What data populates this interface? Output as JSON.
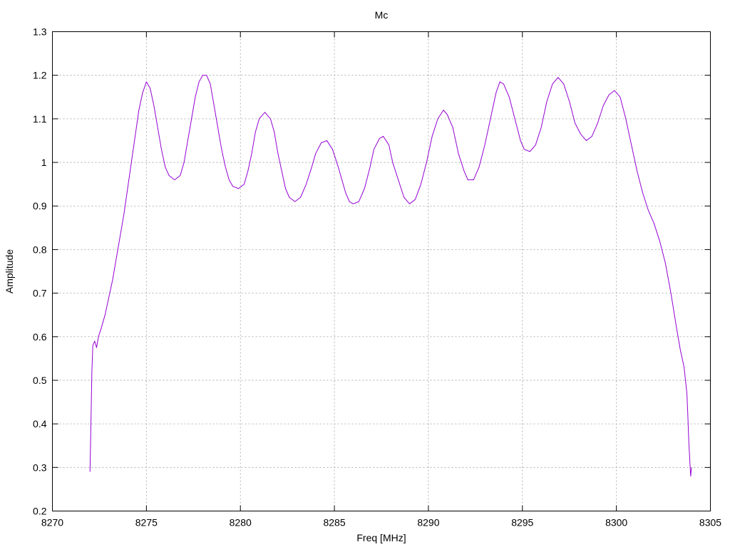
{
  "chart_data": {
    "type": "line",
    "title": "Mc",
    "xlabel": "Freq [MHz]",
    "ylabel": "Amplitude",
    "xlim": [
      8270,
      8305
    ],
    "ylim": [
      0.2,
      1.3
    ],
    "x_ticks": [
      8270,
      8275,
      8280,
      8285,
      8290,
      8295,
      8300,
      8305
    ],
    "y_ticks": [
      0.2,
      0.3,
      0.4,
      0.5,
      0.6,
      0.7,
      0.8,
      0.9,
      1,
      1.1,
      1.2,
      1.3
    ],
    "y_tick_labels": [
      "0.2",
      "0.3",
      "0.4",
      "0.5",
      "0.6",
      "0.7",
      "0.8",
      "0.9",
      "1",
      "1.1",
      "1.2",
      "1.3"
    ],
    "grid": true,
    "legend": "none",
    "series": [
      {
        "color": "#9400d3",
        "points": [
          [
            8272.0,
            0.29
          ],
          [
            8272.05,
            0.4
          ],
          [
            8272.1,
            0.52
          ],
          [
            8272.15,
            0.58
          ],
          [
            8272.25,
            0.59
          ],
          [
            8272.35,
            0.575
          ],
          [
            8272.45,
            0.6
          ],
          [
            8272.6,
            0.62
          ],
          [
            8272.8,
            0.65
          ],
          [
            8273.0,
            0.69
          ],
          [
            8273.2,
            0.73
          ],
          [
            8273.4,
            0.78
          ],
          [
            8273.6,
            0.83
          ],
          [
            8273.8,
            0.88
          ],
          [
            8274.0,
            0.94
          ],
          [
            8274.2,
            1.0
          ],
          [
            8274.4,
            1.06
          ],
          [
            8274.6,
            1.12
          ],
          [
            8274.8,
            1.16
          ],
          [
            8275.0,
            1.185
          ],
          [
            8275.2,
            1.17
          ],
          [
            8275.4,
            1.13
          ],
          [
            8275.6,
            1.08
          ],
          [
            8275.8,
            1.03
          ],
          [
            8276.0,
            0.99
          ],
          [
            8276.2,
            0.97
          ],
          [
            8276.5,
            0.96
          ],
          [
            8276.8,
            0.97
          ],
          [
            8277.0,
            1.0
          ],
          [
            8277.2,
            1.05
          ],
          [
            8277.4,
            1.1
          ],
          [
            8277.6,
            1.15
          ],
          [
            8277.8,
            1.185
          ],
          [
            8278.0,
            1.2
          ],
          [
            8278.2,
            1.2
          ],
          [
            8278.4,
            1.18
          ],
          [
            8278.6,
            1.13
          ],
          [
            8278.8,
            1.08
          ],
          [
            8279.0,
            1.03
          ],
          [
            8279.2,
            0.99
          ],
          [
            8279.4,
            0.96
          ],
          [
            8279.6,
            0.945
          ],
          [
            8279.9,
            0.94
          ],
          [
            8280.2,
            0.95
          ],
          [
            8280.4,
            0.98
          ],
          [
            8280.6,
            1.02
          ],
          [
            8280.8,
            1.07
          ],
          [
            8281.0,
            1.1
          ],
          [
            8281.3,
            1.115
          ],
          [
            8281.6,
            1.1
          ],
          [
            8281.8,
            1.07
          ],
          [
            8282.0,
            1.02
          ],
          [
            8282.2,
            0.98
          ],
          [
            8282.4,
            0.94
          ],
          [
            8282.6,
            0.92
          ],
          [
            8282.9,
            0.91
          ],
          [
            8283.2,
            0.92
          ],
          [
            8283.5,
            0.95
          ],
          [
            8283.8,
            0.99
          ],
          [
            8284.0,
            1.02
          ],
          [
            8284.3,
            1.045
          ],
          [
            8284.6,
            1.05
          ],
          [
            8284.9,
            1.03
          ],
          [
            8285.2,
            0.99
          ],
          [
            8285.4,
            0.96
          ],
          [
            8285.6,
            0.93
          ],
          [
            8285.8,
            0.91
          ],
          [
            8286.0,
            0.905
          ],
          [
            8286.3,
            0.91
          ],
          [
            8286.6,
            0.94
          ],
          [
            8286.9,
            0.99
          ],
          [
            8287.1,
            1.03
          ],
          [
            8287.4,
            1.055
          ],
          [
            8287.6,
            1.06
          ],
          [
            8287.9,
            1.04
          ],
          [
            8288.1,
            1.0
          ],
          [
            8288.4,
            0.96
          ],
          [
            8288.7,
            0.92
          ],
          [
            8289.0,
            0.905
          ],
          [
            8289.3,
            0.915
          ],
          [
            8289.6,
            0.95
          ],
          [
            8289.9,
            1.0
          ],
          [
            8290.2,
            1.06
          ],
          [
            8290.5,
            1.1
          ],
          [
            8290.8,
            1.12
          ],
          [
            8291.0,
            1.11
          ],
          [
            8291.3,
            1.08
          ],
          [
            8291.6,
            1.02
          ],
          [
            8291.9,
            0.98
          ],
          [
            8292.1,
            0.96
          ],
          [
            8292.4,
            0.96
          ],
          [
            8292.7,
            0.99
          ],
          [
            8293.0,
            1.04
          ],
          [
            8293.3,
            1.1
          ],
          [
            8293.6,
            1.16
          ],
          [
            8293.8,
            1.185
          ],
          [
            8294.0,
            1.18
          ],
          [
            8294.3,
            1.15
          ],
          [
            8294.6,
            1.1
          ],
          [
            8294.9,
            1.05
          ],
          [
            8295.1,
            1.03
          ],
          [
            8295.4,
            1.025
          ],
          [
            8295.7,
            1.04
          ],
          [
            8296.0,
            1.08
          ],
          [
            8296.3,
            1.14
          ],
          [
            8296.6,
            1.18
          ],
          [
            8296.9,
            1.195
          ],
          [
            8297.2,
            1.18
          ],
          [
            8297.5,
            1.14
          ],
          [
            8297.8,
            1.09
          ],
          [
            8298.1,
            1.065
          ],
          [
            8298.4,
            1.05
          ],
          [
            8298.7,
            1.06
          ],
          [
            8299.0,
            1.09
          ],
          [
            8299.3,
            1.13
          ],
          [
            8299.6,
            1.155
          ],
          [
            8299.9,
            1.165
          ],
          [
            8300.2,
            1.15
          ],
          [
            8300.5,
            1.1
          ],
          [
            8300.8,
            1.04
          ],
          [
            8301.1,
            0.98
          ],
          [
            8301.4,
            0.93
          ],
          [
            8301.7,
            0.89
          ],
          [
            8302.0,
            0.86
          ],
          [
            8302.3,
            0.82
          ],
          [
            8302.6,
            0.77
          ],
          [
            8302.9,
            0.7
          ],
          [
            8303.2,
            0.62
          ],
          [
            8303.4,
            0.57
          ],
          [
            8303.6,
            0.53
          ],
          [
            8303.75,
            0.47
          ],
          [
            8303.8,
            0.42
          ],
          [
            8303.85,
            0.36
          ],
          [
            8303.95,
            0.28
          ],
          [
            8304.0,
            0.3
          ]
        ]
      }
    ]
  }
}
